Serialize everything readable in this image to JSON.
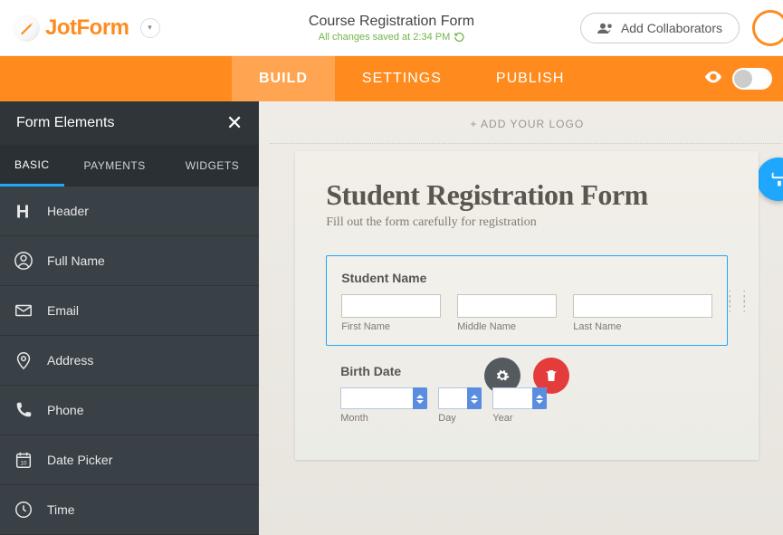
{
  "logo_text": "JotForm",
  "top": {
    "form_title": "Course Registration Form",
    "save_status": "All changes saved at 2:34 PM",
    "collab_label": "Add Collaborators"
  },
  "tabs": {
    "build": "BUILD",
    "settings": "SETTINGS",
    "publish": "PUBLISH"
  },
  "panel": {
    "title": "Form Elements",
    "tabs": {
      "basic": "BASIC",
      "payments": "PAYMENTS",
      "widgets": "WIDGETS"
    },
    "items": [
      {
        "label": "Header"
      },
      {
        "label": "Full Name"
      },
      {
        "label": "Email"
      },
      {
        "label": "Address"
      },
      {
        "label": "Phone"
      },
      {
        "label": "Date Picker"
      },
      {
        "label": "Time"
      }
    ]
  },
  "canvas": {
    "add_logo": "+ ADD YOUR LOGO",
    "title": "Student Registration Form",
    "subtitle": "Fill out the form carefully for registration",
    "student_name_label": "Student Name",
    "first_name": "First Name",
    "middle_name": "Middle Name",
    "last_name": "Last Name",
    "birth_date_label": "Birth Date",
    "month": "Month",
    "day": "Day",
    "year": "Year"
  }
}
